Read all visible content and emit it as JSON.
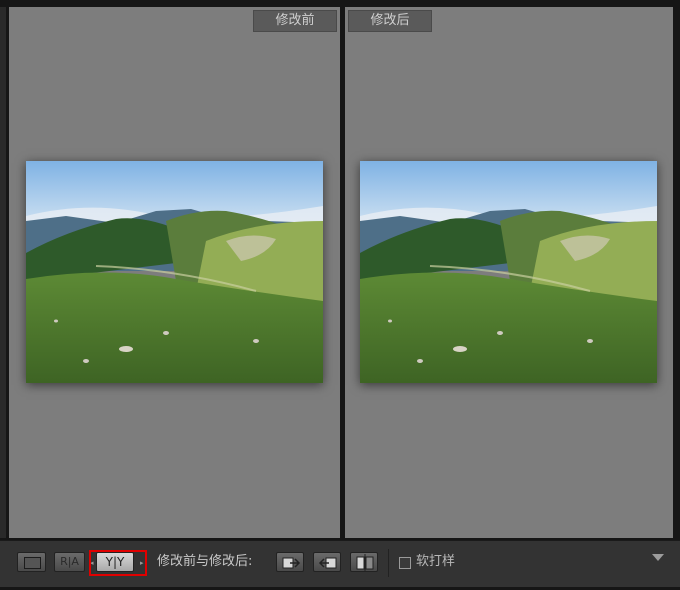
{
  "panes": {
    "before_label": "修改前",
    "after_label": "修改后"
  },
  "toolbar": {
    "ra_label": "R|A",
    "yy_label": "Y|Y",
    "before_after_caption": "修改前与修改后:",
    "softproof_label": "软打样"
  },
  "colors": {
    "pane_bg": "#7d7d7d",
    "toolbar_bg": "#333333",
    "highlight": "#e00000"
  },
  "icons": {
    "loupe": "loupe-view-icon",
    "swap_right": "copy-before-to-after-icon",
    "swap_left": "copy-after-to-before-icon",
    "swap": "swap-before-after-icon",
    "menu": "chevron-down-icon"
  }
}
